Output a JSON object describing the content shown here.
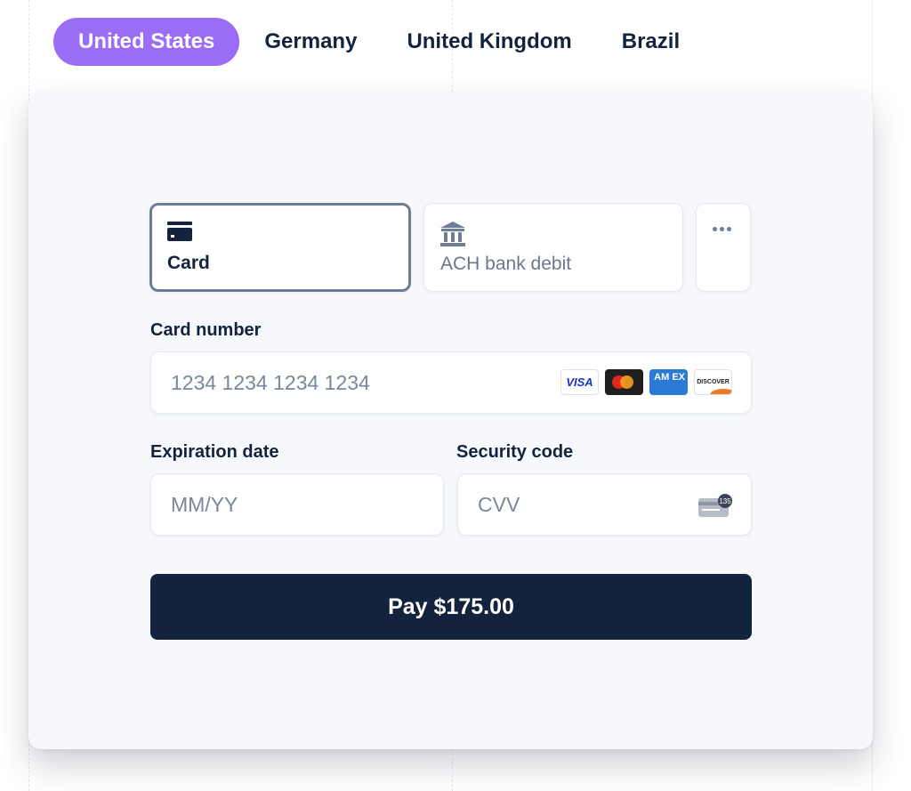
{
  "country_tabs": [
    {
      "label": "United States",
      "active": true
    },
    {
      "label": "Germany",
      "active": false
    },
    {
      "label": "United Kingdom",
      "active": false
    },
    {
      "label": "Brazil",
      "active": false
    }
  ],
  "payment_methods": {
    "card": {
      "label": "Card",
      "icon": "credit-card-icon",
      "selected": true
    },
    "ach": {
      "label": "ACH bank debit",
      "icon": "bank-icon",
      "selected": false
    },
    "more": {
      "icon": "more-horizontal-icon"
    }
  },
  "form": {
    "card_number": {
      "label": "Card number",
      "placeholder": "1234 1234 1234 1234",
      "value": ""
    },
    "card_brands": [
      {
        "name": "visa",
        "text": "VISA"
      },
      {
        "name": "mastercard",
        "text": ""
      },
      {
        "name": "amex",
        "text": "AM EX"
      },
      {
        "name": "discover",
        "text": "DISCOVER"
      }
    ],
    "expiration": {
      "label": "Expiration date",
      "placeholder": "MM/YY",
      "value": ""
    },
    "security_code": {
      "label": "Security code",
      "placeholder": "CVV",
      "value": "",
      "icon_badge": "135"
    }
  },
  "pay_button": {
    "label": "Pay $175.00"
  },
  "colors": {
    "accent": "#9b6cf5",
    "primary": "#13233e",
    "panel_bg": "#f7f8fc"
  }
}
